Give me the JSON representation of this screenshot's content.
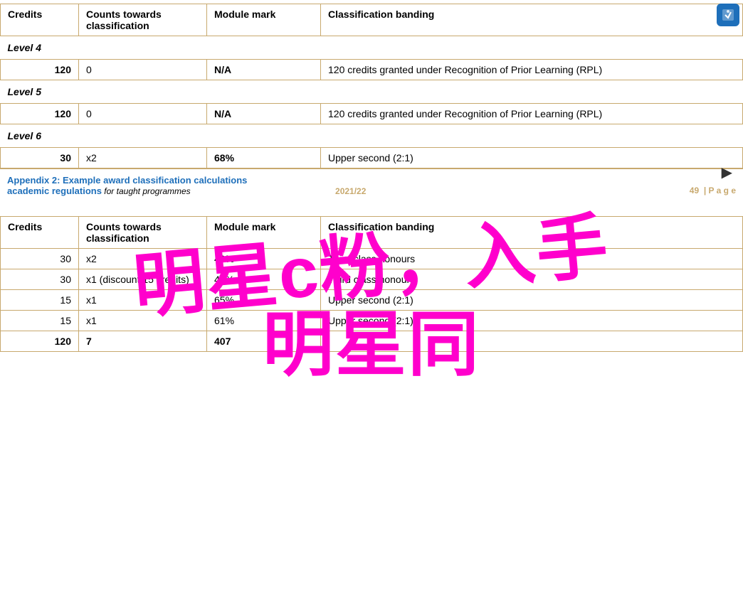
{
  "topIcon": {
    "symbol": "🔗"
  },
  "topTable": {
    "headers": {
      "credits": "Credits",
      "counts": "Counts towards classification",
      "module": "Module mark",
      "classification": "Classification banding"
    },
    "sections": [
      {
        "level": "Level 4",
        "rows": [
          {
            "credits": "120",
            "counts": "0",
            "module": "N/A",
            "classification": "120 credits granted under Recognition of Prior Learning (RPL)"
          }
        ]
      },
      {
        "level": "Level 5",
        "rows": [
          {
            "credits": "120",
            "counts": "0",
            "module": "N/A",
            "classification": "120 credits granted under Recognition of Prior Learning (RPL)"
          }
        ]
      },
      {
        "level": "Level 6",
        "rows": [
          {
            "credits": "30",
            "counts": "x2",
            "module": "68%",
            "classification": "Upper second (2:1)"
          }
        ]
      }
    ]
  },
  "footer": {
    "appendixText": "Appendix 2: Example award classification calculations",
    "academicText": "academic regulations",
    "forText": " for taught programmes",
    "year": "2021/22",
    "pageNum": "49",
    "pageSuffix": "| P a g e"
  },
  "watermark": {
    "line1": "明星c粉，入手",
    "line2": "明星同"
  },
  "bottomTable": {
    "headers": {
      "credits": "Credits",
      "counts": "Counts towards classification",
      "module": "Module mark",
      "classification": "Classification banding"
    },
    "rows": [
      {
        "credits": "30",
        "counts": "x2",
        "module": "49%",
        "classification": "Third class honours"
      },
      {
        "credits": "30",
        "counts": "x1 (discount 15 credits)",
        "module": "47%",
        "classification": "Third class honours"
      },
      {
        "credits": "15",
        "counts": "x1",
        "module": "65%",
        "classification": "Upper second (2:1)"
      },
      {
        "credits": "15",
        "counts": "x1",
        "module": "61%",
        "classification": "Upper second (2:1)"
      },
      {
        "credits": "120",
        "counts": "7",
        "module": "407",
        "classification": ""
      }
    ]
  },
  "cursor": "▶"
}
